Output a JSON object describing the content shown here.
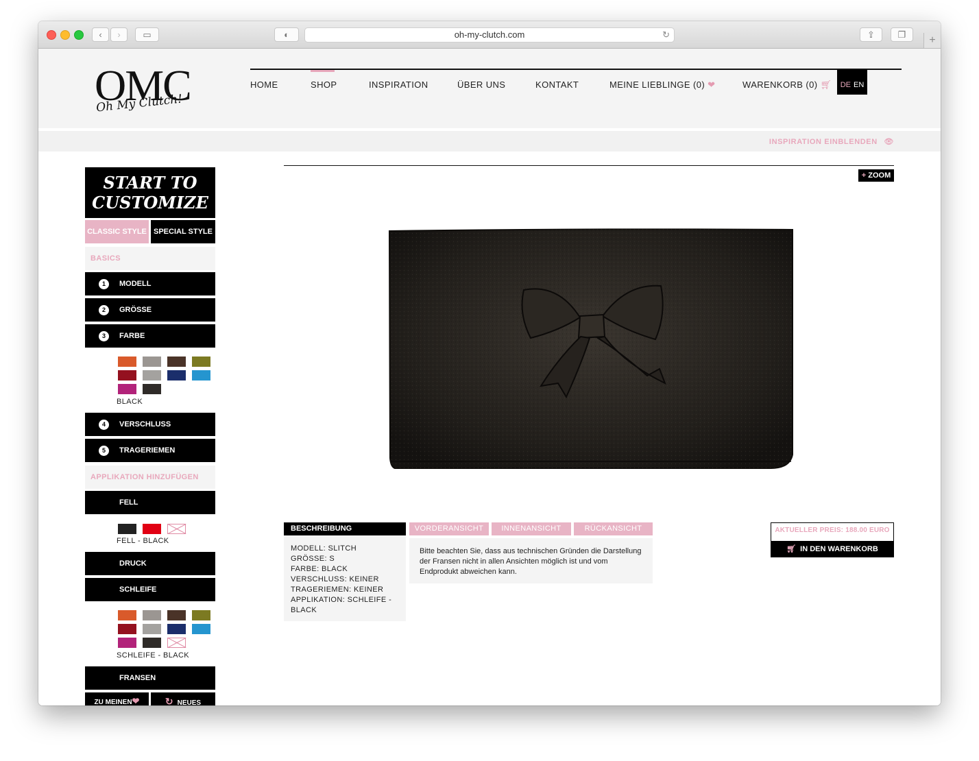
{
  "browser": {
    "url": "oh-my-clutch.com"
  },
  "logo": {
    "main": "OMC",
    "script": "Oh My Clutch!"
  },
  "nav": {
    "home": "HOME",
    "shop": "SHOP",
    "inspiration": "INSPIRATION",
    "about": "ÜBER UNS",
    "contact": "KONTAKT",
    "favorites": "MEINE LIEBLINGE (0)",
    "cart": "WARENKORB (0)",
    "lang_de": "DE",
    "lang_en": "EN",
    "active": "SHOP"
  },
  "inspiration_toggle": "INSPIRATION EINBLENDEN",
  "customizer": {
    "title_line1": "START TO",
    "title_line2": "CUSTOMIZE",
    "tab_classic": "CLASSIC STYLE",
    "tab_special": "SPECIAL STYLE",
    "section_basics": "BASICS",
    "steps": [
      {
        "num": "1",
        "label": "MODELL"
      },
      {
        "num": "2",
        "label": "GRÖSSE"
      },
      {
        "num": "3",
        "label": "FARBE"
      },
      {
        "num": "4",
        "label": "VERSCHLUSS"
      },
      {
        "num": "5",
        "label": "TRAGERIEMEN"
      }
    ],
    "color_caption": "BLACK",
    "section_application": "APPLIKATION HINZUFÜGEN",
    "fell": "FELL",
    "fell_caption": "FELL - BLACK",
    "druck": "DRUCK",
    "schleife": "SCHLEIFE",
    "schleife_caption": "SCHLEIFE - BLACK",
    "fransen": "FRANSEN",
    "to_favorites": "ZU MEINEN",
    "new": "NEUES"
  },
  "swatch_colors": {
    "orange": "#d95a2b",
    "grey": "#9b9692",
    "brown": "#4a3328",
    "olive": "#7c7a22",
    "red": "#94111f",
    "lightgrey": "#a4a29f",
    "navy": "#1b2e6b",
    "cyan": "#2595cf",
    "magenta": "#b2237a",
    "black": "#2f2b28",
    "fell_black": "#222222",
    "fell_red": "#e10013"
  },
  "zoom": "ZOOM",
  "description": {
    "header": "BESCHREIBUNG",
    "lines": [
      "MODELL: SLITCH",
      "GRÖSSE: S",
      "FARBE: BLACK",
      "VERSCHLUSS: KEINER",
      "TRAGERIEMEN: KEINER",
      "APPLIKATION: SCHLEIFE -",
      "BLACK"
    ]
  },
  "views": {
    "front": "VORDERANSICHT",
    "inside": "INNENANSICHT",
    "back": "RÜCKANSICHT"
  },
  "note": "Bitte beachten Sie, dass aus technischen Gründen die Darstellung der Fransen nicht in allen Ansichten möglich ist und vom Endprodukt abweichen kann.",
  "price": {
    "label": "AKTUELLER PREIS: 188.00 EURO",
    "add_to_cart": "IN DEN WARENKORB"
  },
  "theme": {
    "pink": "#e8a8bc",
    "black": "#000000",
    "light_bg": "#f4f4f4"
  }
}
